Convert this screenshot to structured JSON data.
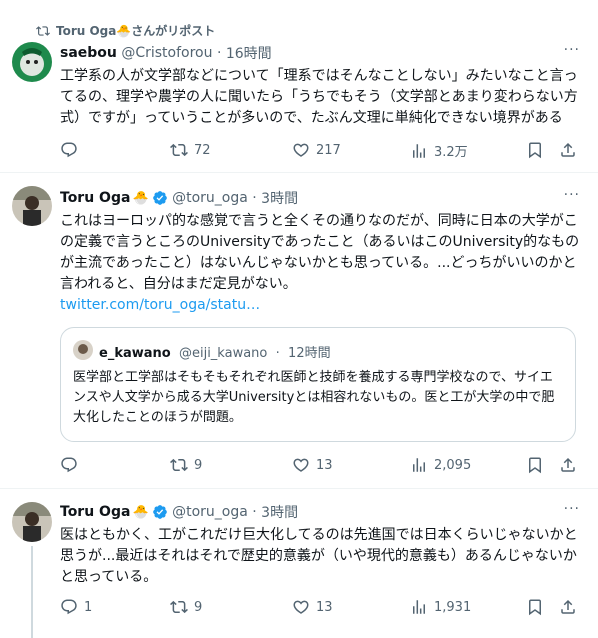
{
  "colors": {
    "accent": "#1d9bf0",
    "muted": "#536471",
    "text": "#0f1419"
  },
  "post1": {
    "repost_label": "Toru Oga🐣さんがリポスト",
    "author": "saebou",
    "handle": "@Cristoforou",
    "dot": "·",
    "time": "16時間",
    "text": "工学系の人が文学部などについて「理系ではそんなことしない」みたいなこと言ってるの、理学や農学の人に聞いたら「うちでもそう（文学部とあまり変わらない方式）ですが」っていうことが多いので、たぶん文理に単純化できない境界がある",
    "reply_count": "",
    "repost_count": "72",
    "like_count": "217",
    "view_count": "3.2万"
  },
  "post2": {
    "author": "Toru Oga",
    "emoji": "🐣",
    "handle": "@toru_oga",
    "dot": "·",
    "time": "3時間",
    "text": "これはヨーロッパ的な感覚で言うと全くその通りなのだが、同時に日本の大学がこの定義で言うところのUniversityであったこと（あるいはこのUniversity的なものが主流であったこと）はないんじゃないかとも思っている。...どっちがいいのかと言われると、自分はまだ定見がない。",
    "link": "twitter.com/toru_oga/statu…",
    "quote": {
      "author": "e_kawano",
      "handle": "@eiji_kawano",
      "dot": "·",
      "time": "12時間",
      "text": "医学部と工学部はそもそもそれぞれ医師と技師を養成する専門学校なので、サイエンスや人文学から成る大学Universityとは相容れないもの。医と工が大学の中で肥大化したことのほうが問題。"
    },
    "reply_count": "",
    "repost_count": "9",
    "like_count": "13",
    "view_count": "2,095"
  },
  "post3": {
    "author": "Toru Oga",
    "emoji": "🐣",
    "handle": "@toru_oga",
    "dot": "·",
    "time": "3時間",
    "text": "医はともかく、工がこれだけ巨大化してるのは先進国では日本くらいじゃないかと思うが...最近はそれはそれで歴史的意義が（いや現代的意義も）あるんじゃないかと思っている。",
    "reply_count": "1",
    "repost_count": "9",
    "like_count": "13",
    "view_count": "1,931"
  },
  "icons": {
    "repost": "repost-icon",
    "reply": "reply-icon",
    "like": "heart-icon",
    "views": "views-icon",
    "bookmark": "bookmark-icon",
    "share": "share-icon",
    "more": "more-icon",
    "verified": "verified-badge-icon"
  },
  "more_glyph": "···"
}
